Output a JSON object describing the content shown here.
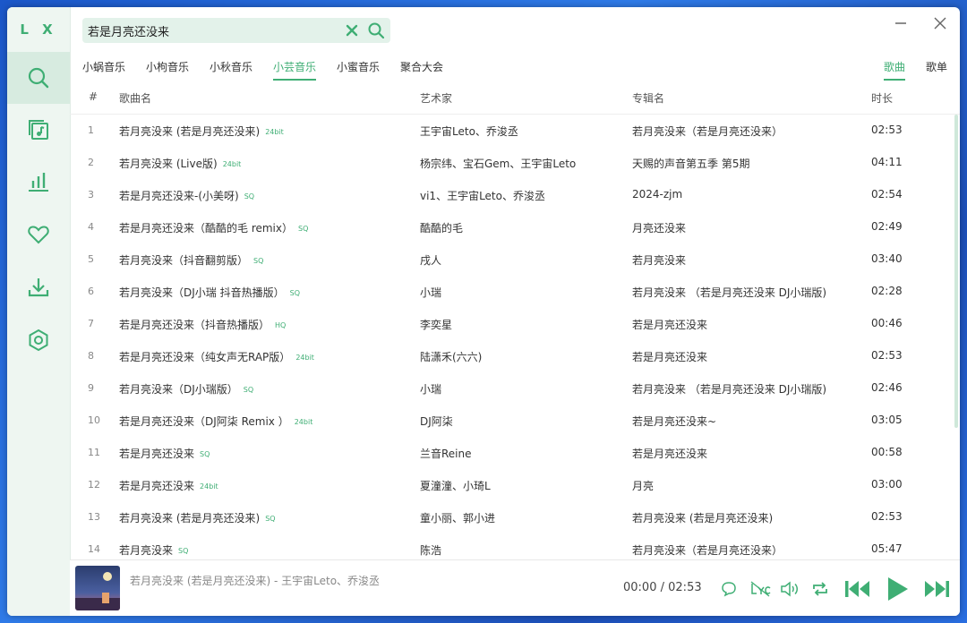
{
  "app": {
    "logo": "L X"
  },
  "search": {
    "value": "若是月亮还没来"
  },
  "source_tabs": [
    "小蜗音乐",
    "小枸音乐",
    "小秋音乐",
    "小芸音乐",
    "小蜜音乐",
    "聚合大会"
  ],
  "active_source_tab": "小芸音乐",
  "type_tabs": [
    "歌曲",
    "歌单"
  ],
  "active_type_tab": "歌曲",
  "columns": {
    "num": "#",
    "name": "歌曲名",
    "artist": "艺术家",
    "album": "专辑名",
    "duration": "时长"
  },
  "songs": [
    {
      "num": "1",
      "name": "若月亮没来 (若是月亮还没来)",
      "quality": "24bit",
      "artist": "王宇宙Leto、乔浚丞",
      "album": "若月亮没来（若是月亮还没来）",
      "duration": "02:53"
    },
    {
      "num": "2",
      "name": "若月亮没来 (Live版)",
      "quality": "24bit",
      "artist": "杨宗纬、宝石Gem、王宇宙Leto",
      "album": "天赐的声音第五季 第5期",
      "duration": "04:11"
    },
    {
      "num": "3",
      "name": "若是月亮还没来-(小美呀)",
      "quality": "SQ",
      "artist": "vi1、王宇宙Leto、乔浚丞",
      "album": "2024-zjm",
      "duration": "02:54"
    },
    {
      "num": "4",
      "name": "若是月亮还没来（酷酷的毛 remix）",
      "quality": "SQ",
      "artist": "酷酷的毛",
      "album": "月亮还没来",
      "duration": "02:49"
    },
    {
      "num": "5",
      "name": "若月亮没来（抖音翻剪版）",
      "quality": "SQ",
      "artist": "戌人",
      "album": "若月亮没来",
      "duration": "03:40"
    },
    {
      "num": "6",
      "name": "若月亮没来（DJ小瑞 抖音热播版）",
      "quality": "SQ",
      "artist": "小瑞",
      "album": "若月亮没来 （若是月亮还没来 DJ小瑞版)",
      "duration": "02:28"
    },
    {
      "num": "7",
      "name": "若是月亮还没来（抖音热播版）",
      "quality": "HQ",
      "artist": "李奕星",
      "album": "若是月亮还没来",
      "duration": "00:46"
    },
    {
      "num": "8",
      "name": "若是月亮还没来（纯女声无RAP版）",
      "quality": "24bit",
      "artist": "陆潇禾(六六)",
      "album": "若是月亮还没来",
      "duration": "02:53"
    },
    {
      "num": "9",
      "name": "若月亮没来（DJ小瑞版）",
      "quality": "SQ",
      "artist": "小瑞",
      "album": "若月亮没来 （若是月亮还没来 DJ小瑞版)",
      "duration": "02:46"
    },
    {
      "num": "10",
      "name": "若是月亮还没来（DJ阿柒 Remix ）",
      "quality": "24bit",
      "artist": "DJ阿柒",
      "album": "若是月亮还没来~",
      "duration": "03:05"
    },
    {
      "num": "11",
      "name": "若是月亮还没来",
      "quality": "SQ",
      "artist": "兰音Reine",
      "album": "若是月亮还没来",
      "duration": "00:58"
    },
    {
      "num": "12",
      "name": "若是月亮还没来",
      "quality": "24bit",
      "artist": "夏潼潼、小琦L",
      "album": "月亮",
      "duration": "03:00"
    },
    {
      "num": "13",
      "name": "若月亮没来 (若是月亮还没来)",
      "quality": "SQ",
      "artist": "童小丽、郭小进",
      "album": "若月亮没来 (若是月亮还没来)",
      "duration": "02:53"
    },
    {
      "num": "14",
      "name": "若月亮没来",
      "quality": "SQ",
      "artist": "陈浩",
      "album": "若月亮没来（若是月亮还没来）",
      "duration": "05:47"
    }
  ],
  "player": {
    "title": "若月亮没来 (若是月亮还没来) - 王宇宙Leto、乔浚丞",
    "current_time": "00:00",
    "separator": "/",
    "total_time": "02:53",
    "cover_text": "若月亮没来"
  },
  "colors": {
    "accent": "#3fae74",
    "sidebar_bg": "#eef6f1",
    "search_bg": "#e3f2ea"
  },
  "icons": {
    "nav": [
      "search-icon",
      "music-list-icon",
      "leaderboard-icon",
      "heart-icon",
      "download-icon",
      "settings-icon"
    ],
    "player": [
      "comment-icon",
      "lyric-off-icon",
      "volume-icon",
      "repeat-icon",
      "previous-icon",
      "play-icon",
      "next-icon"
    ]
  }
}
